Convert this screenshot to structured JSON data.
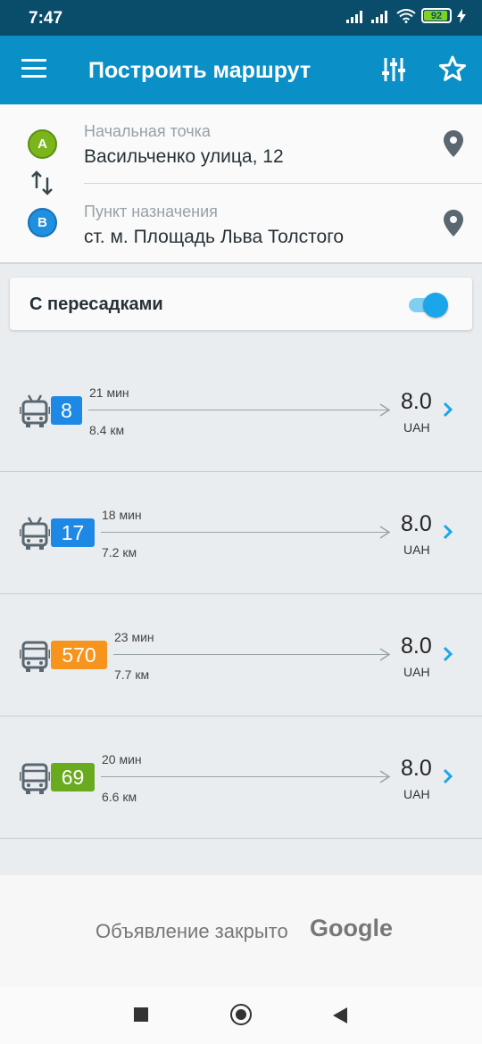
{
  "status_bar": {
    "time": "7:47",
    "battery": "92"
  },
  "app_bar": {
    "title": "Построить маршрут"
  },
  "route_form": {
    "start": {
      "badge": "A",
      "label": "Начальная точка",
      "value": "Васильченко улица, 12"
    },
    "end": {
      "badge": "B",
      "label": "Пункт назначения",
      "value": "ст. м. Площадь Льва Толстого"
    }
  },
  "transfers": {
    "label": "С пересадками",
    "enabled": true
  },
  "routes": [
    {
      "number": "8",
      "color": "#1e88e5",
      "vehicle": "trolleybus-icon",
      "time": "21 мин",
      "distance": "8.4 км",
      "price": "8.0",
      "currency": "UAH"
    },
    {
      "number": "17",
      "color": "#1e88e5",
      "vehicle": "trolleybus-icon",
      "time": "18 мин",
      "distance": "7.2 км",
      "price": "8.0",
      "currency": "UAH"
    },
    {
      "number": "570",
      "color": "#f7941d",
      "vehicle": "bus-icon",
      "time": "23 мин",
      "distance": "7.7 км",
      "price": "8.0",
      "currency": "UAH"
    },
    {
      "number": "69",
      "color": "#6aaa1e",
      "vehicle": "bus-icon",
      "time": "20 мин",
      "distance": "6.6 км",
      "price": "8.0",
      "currency": "UAH"
    }
  ],
  "ad": {
    "text": "Объявление закрыто",
    "brand": "Google"
  },
  "colors": {
    "status_bar": "#0a4d6b",
    "app_bar": "#0a8fc7",
    "toggle": "#1ba6ea",
    "link_chevron": "#1ba6ea"
  }
}
